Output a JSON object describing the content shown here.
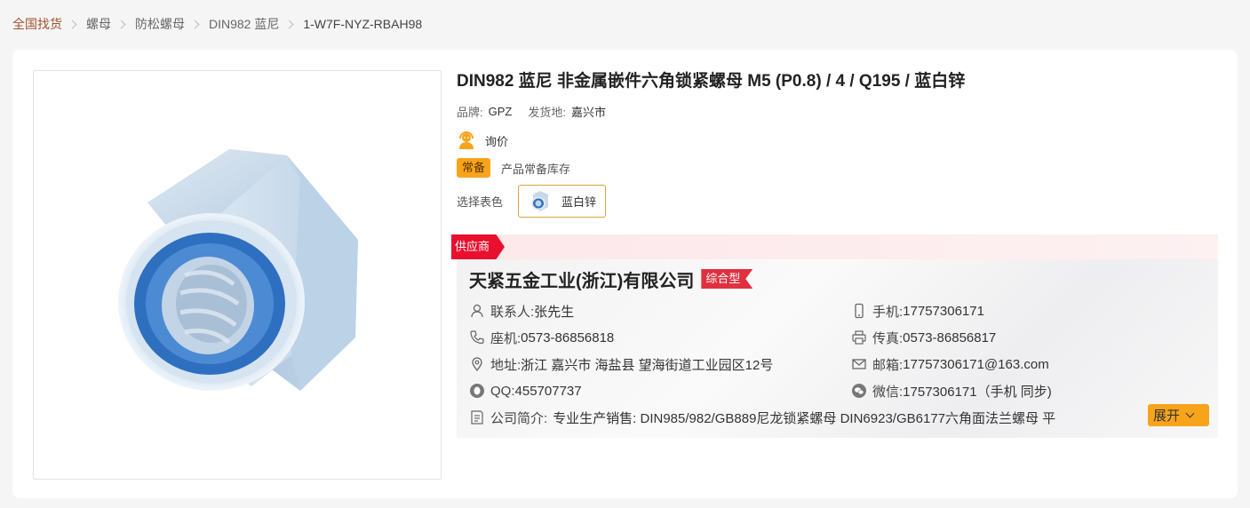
{
  "breadcrumb": [
    "全国找货",
    "螺母",
    "防松螺母",
    "DIN982 蓝尼",
    "1-W7F-NYZ-RBAH98"
  ],
  "product": {
    "title": "DIN982 蓝尼 非金属嵌件六角锁紧螺母 M5 (P0.8) / 4 / Q195 / 蓝白锌",
    "brand_label": "品牌:",
    "brand": "GPZ",
    "origin_label": "发货地:",
    "origin": "嘉兴市",
    "inquiry_label": "询价",
    "stock_badge": "常备",
    "stock_text": "产品常备库存",
    "color_label": "选择表色",
    "color_option": "蓝白锌"
  },
  "supplier": {
    "tag": "供应商",
    "company_name": "天紧五金工业(浙江)有限公司",
    "company_type": "综合型",
    "contact_label": "联系人:",
    "contact": "张先生",
    "mobile_label": "手机:",
    "mobile": "17757306171",
    "phone_label": "座机:",
    "phone": "0573-86856818",
    "fax_label": "传真:",
    "fax": "0573-86856817",
    "address_label": "地址:",
    "address": "浙江 嘉兴市 海盐县 望海街道工业园区12号",
    "email_label": "邮箱:",
    "email": "17757306171@163.com",
    "qq_label": "QQ:",
    "qq": "455707737",
    "wechat_label": "微信:",
    "wechat": "1757306171（手机 同步)",
    "intro_label": "公司简介:",
    "intro": "专业生产销售: DIN985/982/GB889尼龙锁紧螺母 DIN6923/GB6177六角面法兰螺母 平",
    "expand_label": "展开"
  },
  "colors": {
    "accent": "#f7a41b",
    "supplier_red": "#e8102e",
    "type_red": "#e0303e",
    "nut_blue": "#2e6fc0"
  }
}
